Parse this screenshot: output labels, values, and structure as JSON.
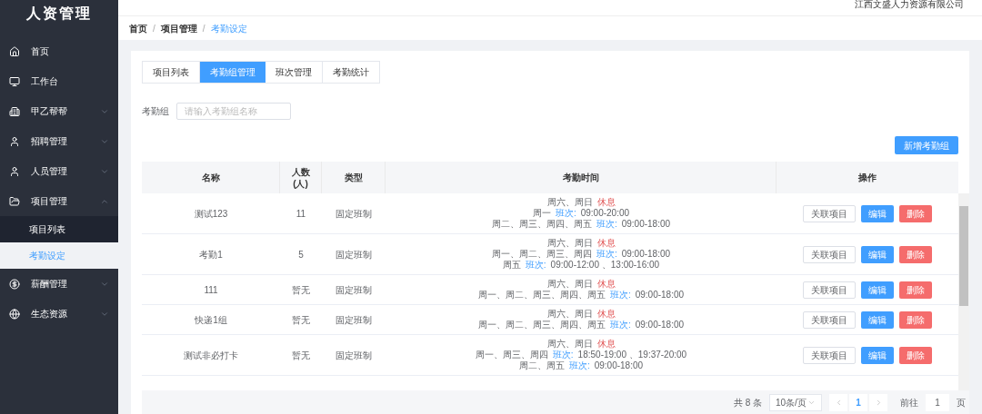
{
  "app": {
    "title": "人资管理",
    "company": "江西文盛人力资源有限公司"
  },
  "sidebar": {
    "items": [
      {
        "label": "首页",
        "has_children": false,
        "expanded": false
      },
      {
        "label": "工作台",
        "has_children": false,
        "expanded": false
      },
      {
        "label": "甲乙帮帮",
        "has_children": true,
        "expanded": false
      },
      {
        "label": "招聘管理",
        "has_children": true,
        "expanded": false
      },
      {
        "label": "人员管理",
        "has_children": true,
        "expanded": false
      },
      {
        "label": "项目管理",
        "has_children": true,
        "expanded": true,
        "children": [
          {
            "label": "项目列表",
            "selected": false
          },
          {
            "label": "考勤设定",
            "selected": true
          }
        ]
      },
      {
        "label": "薪酬管理",
        "has_children": true,
        "expanded": false
      },
      {
        "label": "生态资源",
        "has_children": true,
        "expanded": false
      }
    ]
  },
  "breadcrumb": {
    "separator": "/",
    "items": [
      {
        "label": "首页",
        "current": false
      },
      {
        "label": "项目管理",
        "current": false
      },
      {
        "label": "考勤设定",
        "current": true
      }
    ]
  },
  "tabs": [
    {
      "label": "项目列表",
      "selected": false
    },
    {
      "label": "考勤组管理",
      "selected": true
    },
    {
      "label": "班次管理",
      "selected": false
    },
    {
      "label": "考勤统计",
      "selected": false
    }
  ],
  "filter": {
    "label": "考勤组",
    "placeholder": "请输入考勤组名称"
  },
  "add_button": "新增考勤组",
  "table": {
    "columns": [
      "名称",
      "人数\n(人)",
      "类型",
      "考勤时间",
      "操作"
    ],
    "rows": [
      {
        "name": "测试123",
        "count": "11",
        "type": "固定班制",
        "schedule": [
          {
            "kind": "rest",
            "days": "周六、周日",
            "label": "休息"
          },
          {
            "kind": "shift",
            "days": "周一",
            "label": "班次:",
            "time": "09:00-20:00"
          },
          {
            "kind": "shift",
            "days": "周二、周三、周四、周五",
            "label": "班次:",
            "time": "09:00-18:00"
          }
        ],
        "actions": [
          "关联项目",
          "编辑",
          "删除"
        ]
      },
      {
        "name": "考勤1",
        "count": "5",
        "type": "固定班制",
        "schedule": [
          {
            "kind": "rest",
            "days": "周六、周日",
            "label": "休息"
          },
          {
            "kind": "shift",
            "days": "周一、周二、周三、周四",
            "label": "班次:",
            "time": "09:00-18:00"
          },
          {
            "kind": "shift",
            "days": "周五",
            "label": "班次:",
            "time": "09:00-12:00 、13:00-16:00"
          }
        ],
        "actions": [
          "关联项目",
          "编辑",
          "删除"
        ]
      },
      {
        "name": "111",
        "count": "暂无",
        "type": "固定班制",
        "schedule": [
          {
            "kind": "rest",
            "days": "周六、周日",
            "label": "休息"
          },
          {
            "kind": "shift",
            "days": "周一、周二、周三、周四、周五",
            "label": "班次:",
            "time": "09:00-18:00"
          }
        ],
        "actions": [
          "关联项目",
          "编辑",
          "删除"
        ]
      },
      {
        "name": "快递1组",
        "count": "暂无",
        "type": "固定班制",
        "schedule": [
          {
            "kind": "rest",
            "days": "周六、周日",
            "label": "休息"
          },
          {
            "kind": "shift",
            "days": "周一、周二、周三、周四、周五",
            "label": "班次:",
            "time": "09:00-18:00"
          }
        ],
        "actions": [
          "关联项目",
          "编辑",
          "删除"
        ]
      },
      {
        "name": "测试非必打卡",
        "count": "暂无",
        "type": "固定班制",
        "schedule": [
          {
            "kind": "rest",
            "days": "周六、周日",
            "label": "休息"
          },
          {
            "kind": "shift",
            "days": "周一、周三、周四",
            "label": "班次:",
            "time": "18:50-19:00 、19:37-20:00"
          },
          {
            "kind": "shift",
            "days": "周二、周五",
            "label": "班次:",
            "time": "09:00-18:00"
          }
        ],
        "actions": [
          "关联项目",
          "编辑",
          "删除"
        ]
      }
    ]
  },
  "pagination": {
    "total": "共 8 条",
    "page_size": "10条/页",
    "pages": [
      {
        "label": "1",
        "selected": true
      }
    ],
    "goto_label": "前往",
    "goto_value": "1",
    "goto_suffix": "页"
  }
}
